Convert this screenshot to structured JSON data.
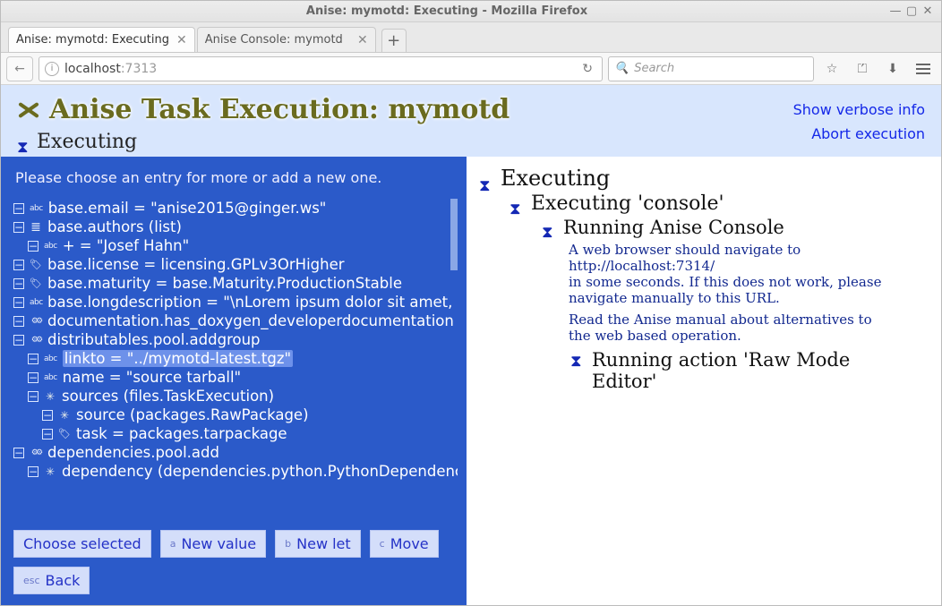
{
  "window": {
    "title": "Anise: mymotd: Executing - Mozilla Firefox"
  },
  "tabs": [
    {
      "label": "Anise: mymotd: Executing",
      "active": true
    },
    {
      "label": "Anise Console: mymotd",
      "active": false
    }
  ],
  "url": {
    "host": "localhost",
    "port": ":7313"
  },
  "search": {
    "placeholder": "Search"
  },
  "header": {
    "title": "Anise Task Execution: mymotd",
    "status": "Executing",
    "link_verbose": "Show verbose info",
    "link_abort": "Abort execution"
  },
  "left": {
    "prompt": "Please choose an entry for more or add a new one.",
    "rows": [
      {
        "indent": 0,
        "icon": "abc",
        "label": "base.email = \"anise2015@ginger.ws\""
      },
      {
        "indent": 0,
        "icon": "list",
        "label": "base.authors (list)"
      },
      {
        "indent": 1,
        "icon": "abc",
        "label": "+ = \"Josef Hahn\""
      },
      {
        "indent": 0,
        "icon": "tag",
        "label": "base.license = licensing.GPLv3OrHigher"
      },
      {
        "indent": 0,
        "icon": "tag",
        "label": "base.maturity = base.Maturity.ProductionStable"
      },
      {
        "indent": 0,
        "icon": "abc",
        "label": "base.longdescription = \"\\nLorem ipsum dolor sit amet,"
      },
      {
        "indent": 0,
        "icon": "gears",
        "label": "documentation.has_doxygen_developerdocumentation"
      },
      {
        "indent": 0,
        "icon": "gears",
        "label": "distributables.pool.addgroup"
      },
      {
        "indent": 1,
        "icon": "abc",
        "label": "linkto = \"../mymotd-latest.tgz\"",
        "selected": true
      },
      {
        "indent": 1,
        "icon": "abc",
        "label": "name = \"source tarball\""
      },
      {
        "indent": 1,
        "icon": "star",
        "label": "sources (files.TaskExecution)"
      },
      {
        "indent": 2,
        "icon": "star",
        "label": "source (packages.RawPackage)"
      },
      {
        "indent": 2,
        "icon": "tag",
        "label": "task = packages.tarpackage"
      },
      {
        "indent": 0,
        "icon": "gears",
        "label": "dependencies.pool.add"
      },
      {
        "indent": 1,
        "icon": "star",
        "label": "dependency (dependencies.python.PythonDependency"
      }
    ],
    "actions": {
      "choose": "Choose selected",
      "newval": "New value",
      "newval_k": "a",
      "newlet": "New let",
      "newlet_k": "b",
      "move": "Move",
      "move_k": "c",
      "back": "Back",
      "back_k": "esc"
    }
  },
  "right": {
    "l0": "Executing",
    "l1": "Executing 'console'",
    "l2": "Running Anise Console",
    "msg1": "A web browser should navigate to http://localhost:7314/\nin some seconds. If this does not work, please navigate manually to this URL.",
    "msg2": "Read the Anise manual about alternatives to the web based operation.",
    "l3": "Running action 'Raw Mode Editor'"
  }
}
